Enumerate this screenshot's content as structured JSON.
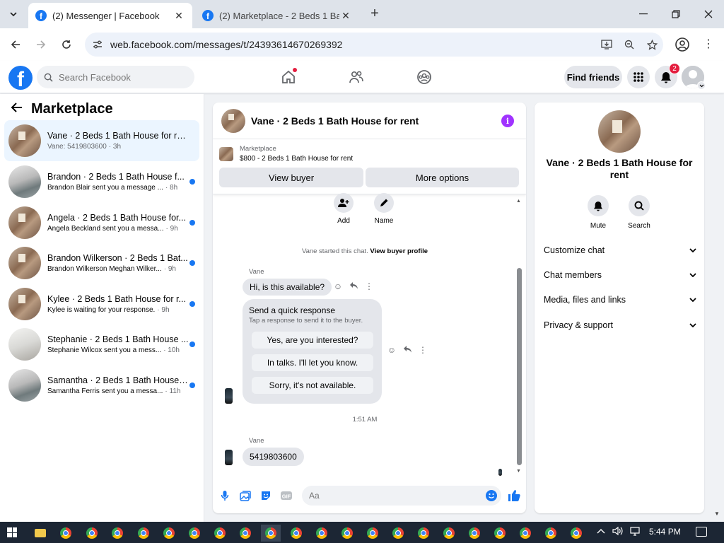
{
  "browser": {
    "tabs": [
      {
        "title": "(2) Messenger | Facebook",
        "active": true
      },
      {
        "title": "(2) Marketplace - 2 Beds 1 Bath",
        "active": false
      }
    ],
    "url": "web.facebook.com/messages/t/24393614670269392"
  },
  "header": {
    "search_placeholder": "Search Facebook",
    "find_friends": "Find friends",
    "notification_count": "2"
  },
  "sidebar": {
    "title": "Marketplace",
    "conversations": [
      {
        "title": "Vane · 2 Beds 1 Bath House for rent",
        "snippet": "Vane: 5419803600",
        "time": "· 3h",
        "unread": false,
        "selected": true
      },
      {
        "title": "Brandon · 2 Beds 1 Bath House f...",
        "snippet": "Brandon Blair sent you a message ...",
        "time": "· 8h",
        "unread": true
      },
      {
        "title": "Angela · 2 Beds 1 Bath House for...",
        "snippet": "Angela Beckland sent you a messa...",
        "time": "· 9h",
        "unread": true
      },
      {
        "title": "Brandon Wilkerson · 2 Beds 1 Bat...",
        "snippet": "Brandon Wilkerson Meghan Wilker...",
        "time": "· 9h",
        "unread": true
      },
      {
        "title": "Kylee · 2 Beds 1 Bath House for r...",
        "snippet": "Kylee is waiting for your response.",
        "time": "· 9h",
        "unread": true
      },
      {
        "title": "Stephanie · 2 Beds 1 Bath House ...",
        "snippet": "Stephanie Wilcox sent you a mess...",
        "time": "· 10h",
        "unread": true
      },
      {
        "title": "Samantha · 2 Beds 1 Bath House ...",
        "snippet": "Samantha Ferris sent you a messa...",
        "time": "· 11h",
        "unread": true
      }
    ]
  },
  "chat": {
    "title": "Vane · 2 Beds 1 Bath House for rent",
    "listing_label": "Marketplace",
    "listing_value": "$800 - 2 Beds 1 Bath House for rent",
    "view_buyer": "View buyer",
    "more_options": "More options",
    "actions": [
      {
        "label": "Add"
      },
      {
        "label": "Name"
      }
    ],
    "system_message": "Vane started this chat.",
    "system_link": "View buyer profile",
    "sender_name": "Vane",
    "first_message": "Hi, is this available?",
    "quick_response": {
      "title": "Send a quick response",
      "subtitle": "Tap a response to send it to the buyer.",
      "options": [
        "Yes, are you interested?",
        "In talks. I'll let you know.",
        "Sorry, it's not available."
      ]
    },
    "timestamp": "1:51 AM",
    "last_message": "5419803600",
    "composer_placeholder": "Aa"
  },
  "details": {
    "name": "Vane · 2 Beds 1 Bath House for rent",
    "actions": [
      {
        "label": "Mute"
      },
      {
        "label": "Search"
      }
    ],
    "sections": [
      "Customize chat",
      "Chat members",
      "Media, files and links",
      "Privacy & support"
    ]
  },
  "taskbar": {
    "clock": "5:44 PM"
  },
  "colors": {
    "accent": "#1877f2",
    "info": "#a033ff",
    "badge": "#e41e3f"
  }
}
